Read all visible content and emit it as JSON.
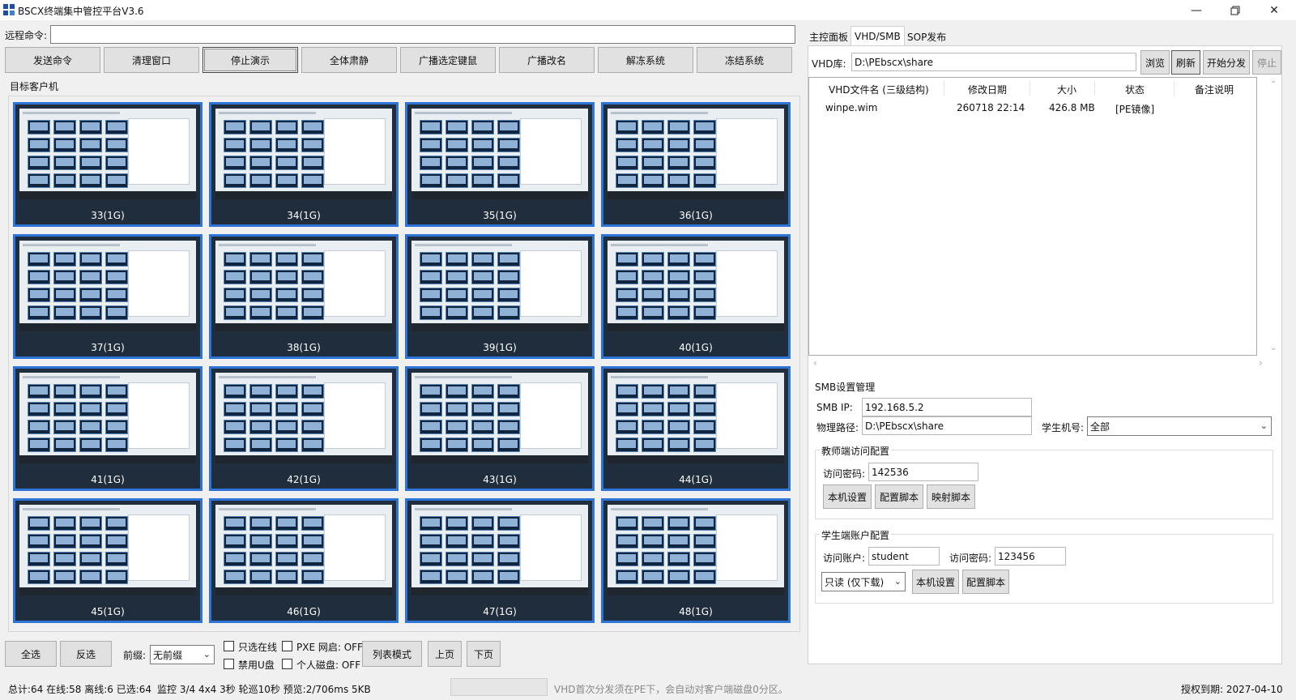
{
  "window": {
    "title": "BSCX终端集中管控平台V3.6"
  },
  "remote": {
    "label": "远程命令:",
    "value": ""
  },
  "toolbar": [
    "发送命令",
    "清理窗口",
    "停止演示",
    "全体肃静",
    "广播选定键鼠",
    "广播改名",
    "解冻系统",
    "冻结系统"
  ],
  "section": {
    "target_clients": "目标客户机"
  },
  "clients": [
    "33(1G)",
    "34(1G)",
    "35(1G)",
    "36(1G)",
    "37(1G)",
    "38(1G)",
    "39(1G)",
    "40(1G)",
    "41(1G)",
    "42(1G)",
    "43(1G)",
    "44(1G)",
    "45(1G)",
    "46(1G)",
    "47(1G)",
    "48(1G)"
  ],
  "bottom": {
    "select_all": "全选",
    "invert": "反选",
    "prefix_label": "前缀:",
    "prefix_value": "无前缀",
    "only_online": "只选在线",
    "pxe_wake": "PXE 网启: OFF",
    "disable_usb": "禁用U盘",
    "personal_disk": "个人磁盘: OFF",
    "list_mode": "列表模式",
    "prev_page": "上页",
    "next_page": "下页"
  },
  "status": {
    "counts": "总计:64 在线:58 离线:6 已选:64",
    "monitor": "监控 3/4 4x4 3秒 轮巡10秒 预览:2/706ms 5KB",
    "hint": "VHD首次分发须在PE下，会自动对客户端磁盘0分区。",
    "license": "授权到期: 2027-04-10"
  },
  "right": {
    "tabs": [
      "主控面板",
      "VHD/SMB",
      "SOP发布"
    ],
    "vhd_label": "VHD库:",
    "vhd_path": "D:\\PEbscx\\share",
    "buttons": [
      "浏览",
      "刷新",
      "开始分发",
      "停止"
    ],
    "table": {
      "headers": [
        "VHD文件名 (三级结构)",
        "修改日期",
        "大小",
        "状态",
        "备注说明"
      ],
      "rows": [
        {
          "name": "winpe.wim",
          "date": "260718 22:14",
          "size": "426.8 MB",
          "status": "[PE镜像]",
          "note": ""
        }
      ]
    },
    "smb": {
      "title": "SMB设置管理",
      "ip_label": "SMB IP:",
      "ip_value": "192.168.5.2",
      "path_label": "物理路径:",
      "path_value": "D:\\PEbscx\\share",
      "student_label": "学生机号:",
      "student_value": "全部"
    },
    "teacher": {
      "title": "教师端访问配置",
      "pwd_label": "访问密码:",
      "pwd_value": "142536",
      "buttons": [
        "本机设置",
        "配置脚本",
        "映射脚本"
      ]
    },
    "student": {
      "title": "学生端账户配置",
      "acct_label": "访问账户:",
      "acct_value": "student",
      "pwd_label": "访问密码:",
      "pwd_value": "123456",
      "mode_value": "只读 (仅下载)",
      "buttons": [
        "本机设置",
        "配置脚本"
      ]
    }
  }
}
